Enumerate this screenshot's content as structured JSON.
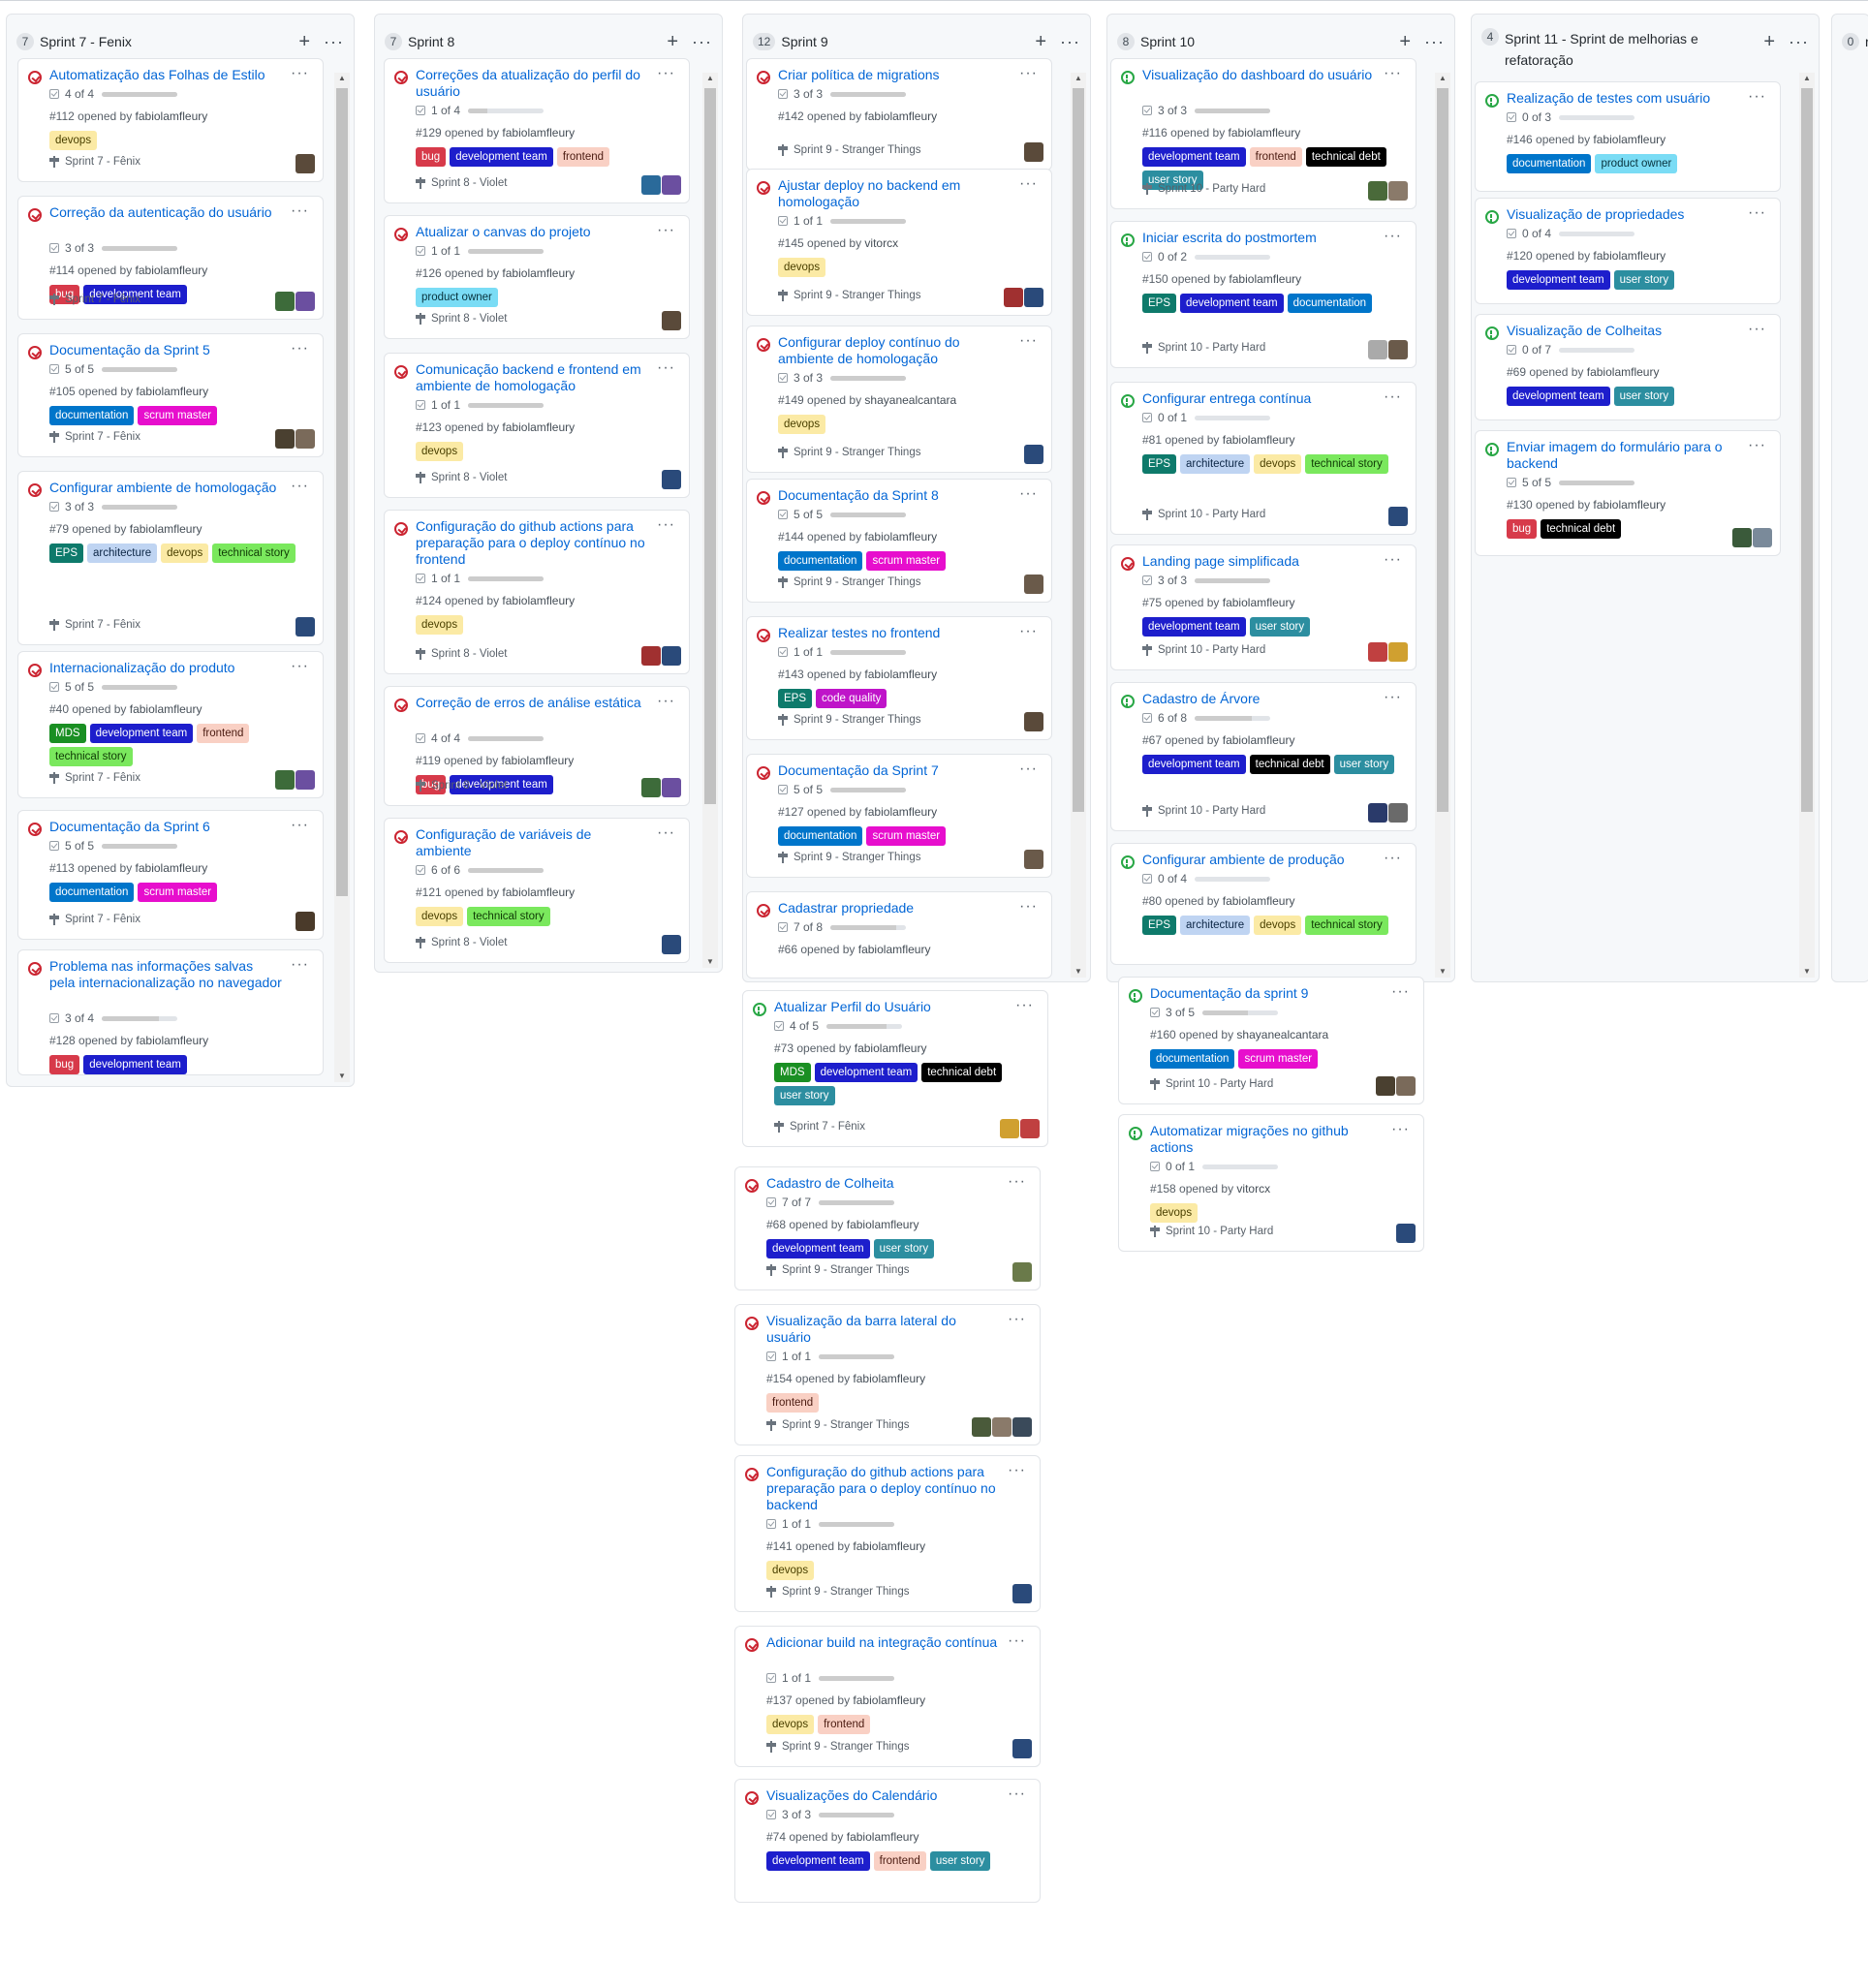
{
  "label_colors": {
    "devops": [
      "#fbeaa5",
      "#4a4000"
    ],
    "bug": [
      "#d73a4a",
      "#ffffff"
    ],
    "development team": [
      "#1d1ecc",
      "#ffffff"
    ],
    "frontend": [
      "#f9d0c4",
      "#4a1a10"
    ],
    "documentation": [
      "#0075ca",
      "#ffffff"
    ],
    "scrum master": [
      "#e70ecd",
      "#ffffff"
    ],
    "EPS": [
      "#0e7a6b",
      "#ffffff"
    ],
    "architecture": [
      "#bfd4f2",
      "#0b2545"
    ],
    "technical story": [
      "#7ae85d",
      "#0f3a05"
    ],
    "MDS": [
      "#1a8f23",
      "#ffffff"
    ],
    "product owner": [
      "#7adcf5",
      "#07313b"
    ],
    "code quality": [
      "#bf14c9",
      "#ffffff"
    ],
    "technical debt": [
      "#000000",
      "#ffffff"
    ],
    "user story": [
      "#2c8ea0",
      "#ffffff"
    ]
  },
  "columns": [
    {
      "count": "7",
      "title": "Sprint 7 - Fenix",
      "cards": [
        {
          "state": "closed",
          "title": "Automatização das Folhas de Estilo",
          "progress": "4 of 4",
          "done": 1.0,
          "number": "#112",
          "opened_by": "opened by",
          "author": "fabiolamfleury",
          "labels": [
            "devops"
          ],
          "milestone": "Sprint 7 - Fênix",
          "avatars": [
            "#5a4a3a"
          ]
        },
        {
          "state": "closed",
          "title": "Correção da autenticação do usuário",
          "progress": "3 of 3",
          "done": 1.0,
          "number": "#114",
          "opened_by": "opened by",
          "author": "fabiolamfleury",
          "labels": [
            "bug",
            "development team"
          ],
          "milestone": "Sprint 7 - Fênix",
          "avatars": [
            "#3d6b3a",
            "#6b4fa0"
          ]
        },
        {
          "state": "closed",
          "title": "Documentação da Sprint 5",
          "progress": "5 of 5",
          "done": 1.0,
          "number": "#105",
          "opened_by": "opened by",
          "author": "fabiolamfleury",
          "labels": [
            "documentation",
            "scrum master"
          ],
          "milestone": "Sprint 7 - Fênix",
          "avatars": [
            "#4a4030",
            "#7a6a5a"
          ]
        },
        {
          "state": "closed",
          "title": "Configurar ambiente de homologação",
          "progress": "3 of 3",
          "done": 1.0,
          "number": "#79",
          "opened_by": "opened by",
          "author": "fabiolamfleury",
          "labels": [
            "EPS",
            "architecture",
            "devops",
            "technical story"
          ],
          "milestone": "Sprint 7 - Fênix",
          "avatars": [
            "#2a4a7a"
          ]
        },
        {
          "state": "closed",
          "title": "Internacionalização do produto",
          "progress": "5 of 5",
          "done": 1.0,
          "number": "#40",
          "opened_by": "opened by",
          "author": "fabiolamfleury",
          "labels": [
            "MDS",
            "development team",
            "frontend",
            "technical story"
          ],
          "milestone": "Sprint 7 - Fênix",
          "avatars": [
            "#3d6b3a",
            "#6b4fa0"
          ]
        },
        {
          "state": "closed",
          "title": "Documentação da Sprint 6",
          "progress": "5 of 5",
          "done": 1.0,
          "number": "#113",
          "opened_by": "opened by",
          "author": "fabiolamfleury",
          "labels": [
            "documentation",
            "scrum master"
          ],
          "milestone": "Sprint 7 - Fênix",
          "avatars": [
            "#4a3a2a"
          ]
        },
        {
          "state": "closed",
          "title": "Problema nas informações salvas pela internacionalização no navegador",
          "progress": "3 of 4",
          "done": 0.75,
          "number": "#128",
          "opened_by": "opened by",
          "author": "fabiolamfleury",
          "labels": [
            "bug",
            "development team"
          ],
          "milestone": "",
          "avatars": []
        }
      ]
    },
    {
      "count": "7",
      "title": "Sprint 8",
      "cards": [
        {
          "state": "closed",
          "title": "Correções da atualização do perfil do usuário",
          "progress": "1 of 4",
          "done": 0.25,
          "number": "#129",
          "opened_by": "opened by",
          "author": "fabiolamfleury",
          "labels": [
            "bug",
            "development team",
            "frontend"
          ],
          "milestone": "Sprint 8 - Violet",
          "avatars": [
            "#2a6a9a",
            "#6b4fa0"
          ]
        },
        {
          "state": "closed",
          "title": "Atualizar o canvas do projeto",
          "progress": "1 of 1",
          "done": 1.0,
          "number": "#126",
          "opened_by": "opened by",
          "author": "fabiolamfleury",
          "labels": [
            "product owner"
          ],
          "milestone": "Sprint 8 - Violet",
          "avatars": [
            "#5a4a3a"
          ]
        },
        {
          "state": "closed",
          "title": "Comunicação backend e frontend em ambiente de homologação",
          "progress": "1 of 1",
          "done": 1.0,
          "number": "#123",
          "opened_by": "opened by",
          "author": "fabiolamfleury",
          "labels": [
            "devops"
          ],
          "milestone": "Sprint 8 - Violet",
          "avatars": [
            "#2a4a7a"
          ]
        },
        {
          "state": "closed",
          "title": "Configuração do github actions para preparação para o deploy contínuo no frontend",
          "progress": "1 of 1",
          "done": 1.0,
          "number": "#124",
          "opened_by": "opened by",
          "author": "fabiolamfleury",
          "labels": [
            "devops"
          ],
          "milestone": "Sprint 8 - Violet",
          "avatars": [
            "#a03030",
            "#2a4a7a"
          ]
        },
        {
          "state": "closed",
          "title": "Correção de erros de análise estática",
          "progress": "4 of 4",
          "done": 1.0,
          "number": "#119",
          "opened_by": "opened by",
          "author": "fabiolamfleury",
          "labels": [
            "bug",
            "development team"
          ],
          "milestone": "Sprint 8 - Violet",
          "avatars": [
            "#3d6b3a",
            "#6b4fa0"
          ]
        },
        {
          "state": "closed",
          "title": "Configuração de variáveis de ambiente",
          "progress": "6 of 6",
          "done": 1.0,
          "number": "#121",
          "opened_by": "opened by",
          "author": "fabiolamfleury",
          "labels": [
            "devops",
            "technical story"
          ],
          "milestone": "Sprint 8 - Violet",
          "avatars": [
            "#2a4a7a"
          ]
        }
      ]
    },
    {
      "count": "12",
      "title": "Sprint 9",
      "cards": [
        {
          "state": "closed",
          "title": "Criar política de migrations",
          "progress": "3 of 3",
          "done": 1.0,
          "number": "#142",
          "opened_by": "opened by",
          "author": "fabiolamfleury",
          "labels": [],
          "milestone": "Sprint 9 - Stranger Things",
          "avatars": [
            "#5a4a3a"
          ]
        },
        {
          "state": "closed",
          "title": "Ajustar deploy no backend em homologação",
          "progress": "1 of 1",
          "done": 1.0,
          "number": "#145",
          "opened_by": "opened by",
          "author": "vitorcx",
          "labels": [
            "devops"
          ],
          "milestone": "Sprint 9 - Stranger Things",
          "avatars": [
            "#a03030",
            "#2a4a7a"
          ]
        },
        {
          "state": "closed",
          "title": "Configurar deploy contínuo do ambiente de homologação",
          "progress": "3 of 3",
          "done": 1.0,
          "number": "#149",
          "opened_by": "opened by",
          "author": "shayanealcantara",
          "labels": [
            "devops"
          ],
          "milestone": "Sprint 9 - Stranger Things",
          "avatars": [
            "#2a4a7a"
          ]
        },
        {
          "state": "closed",
          "title": "Documentação da Sprint 8",
          "progress": "5 of 5",
          "done": 1.0,
          "number": "#144",
          "opened_by": "opened by",
          "author": "fabiolamfleury",
          "labels": [
            "documentation",
            "scrum master"
          ],
          "milestone": "Sprint 9 - Stranger Things",
          "avatars": [
            "#6a5a4a"
          ]
        },
        {
          "state": "closed",
          "title": "Realizar testes no frontend",
          "progress": "1 of 1",
          "done": 1.0,
          "number": "#143",
          "opened_by": "opened by",
          "author": "fabiolamfleury",
          "labels": [
            "EPS",
            "code quality"
          ],
          "milestone": "Sprint 9 - Stranger Things",
          "avatars": [
            "#5a4a3a"
          ]
        },
        {
          "state": "closed",
          "title": "Documentação da Sprint 7",
          "progress": "5 of 5",
          "done": 1.0,
          "number": "#127",
          "opened_by": "opened by",
          "author": "fabiolamfleury",
          "labels": [
            "documentation",
            "scrum master"
          ],
          "milestone": "Sprint 9 - Stranger Things",
          "avatars": [
            "#6a5a4a"
          ]
        },
        {
          "state": "closed",
          "title": "Cadastrar propriedade",
          "progress": "7 of 8",
          "done": 0.875,
          "number": "#66",
          "opened_by": "opened by",
          "author": "fabiolamfleury",
          "labels": [],
          "milestone": "",
          "avatars": []
        }
      ]
    },
    {
      "count": "8",
      "title": "Sprint 10",
      "cards": [
        {
          "state": "open",
          "title": "Visualização do dashboard do usuário",
          "progress": "3 of 3",
          "done": 1.0,
          "number": "#116",
          "opened_by": "opened by",
          "author": "fabiolamfleury",
          "labels": [
            "development team",
            "frontend",
            "technical debt",
            "user story"
          ],
          "milestone": "Sprint 10 - Party Hard",
          "avatars": [
            "#4a6a3a",
            "#8a7a6a"
          ]
        },
        {
          "state": "open",
          "title": "Iniciar escrita do postmortem",
          "progress": "0 of 2",
          "done": 0.0,
          "number": "#150",
          "opened_by": "opened by",
          "author": "fabiolamfleury",
          "labels": [
            "EPS",
            "development team",
            "documentation"
          ],
          "milestone": "Sprint 10 - Party Hard",
          "avatars": [
            "#aaaaaa",
            "#6a5a4a"
          ]
        },
        {
          "state": "open",
          "title": "Configurar entrega contínua",
          "progress": "0 of 1",
          "done": 0.0,
          "number": "#81",
          "opened_by": "opened by",
          "author": "fabiolamfleury",
          "labels": [
            "EPS",
            "architecture",
            "devops",
            "technical story"
          ],
          "milestone": "Sprint 10 - Party Hard",
          "avatars": [
            "#2a4a7a"
          ]
        },
        {
          "state": "closed",
          "title": "Landing page simplificada",
          "progress": "3 of 3",
          "done": 1.0,
          "number": "#75",
          "opened_by": "opened by",
          "author": "fabiolamfleury",
          "labels": [
            "development team",
            "user story"
          ],
          "milestone": "Sprint 10 - Party Hard",
          "avatars": [
            "#c04040",
            "#d0a030"
          ]
        },
        {
          "state": "open",
          "title": "Cadastro de Árvore",
          "progress": "6 of 8",
          "done": 0.75,
          "number": "#67",
          "opened_by": "opened by",
          "author": "fabiolamfleury",
          "labels": [
            "development team",
            "technical debt",
            "user story"
          ],
          "milestone": "Sprint 10 - Party Hard",
          "avatars": [
            "#2a3a6a",
            "#6a6a6a"
          ]
        },
        {
          "state": "open",
          "title": "Configurar ambiente de produção",
          "progress": "0 of 4",
          "done": 0.0,
          "number": "#80",
          "opened_by": "opened by",
          "author": "fabiolamfleury",
          "labels": [
            "EPS",
            "architecture",
            "devops",
            "technical story"
          ],
          "milestone": "",
          "avatars": []
        }
      ]
    },
    {
      "count": "4",
      "title": "Sprint 11 - Sprint de melhorias e refatoração",
      "cards": [
        {
          "state": "open",
          "title": "Realização de testes com usuário",
          "progress": "0 of 3",
          "done": 0.0,
          "number": "#146",
          "opened_by": "opened by",
          "author": "fabiolamfleury",
          "labels": [
            "documentation",
            "product owner"
          ],
          "milestone": "",
          "avatars": []
        },
        {
          "state": "open",
          "title": "Visualização de propriedades",
          "progress": "0 of 4",
          "done": 0.0,
          "number": "#120",
          "opened_by": "opened by",
          "author": "fabiolamfleury",
          "labels": [
            "development team",
            "user story"
          ],
          "milestone": "",
          "avatars": []
        },
        {
          "state": "open",
          "title": "Visualização de Colheitas",
          "progress": "0 of 7",
          "done": 0.0,
          "number": "#69",
          "opened_by": "opened by",
          "author": "fabiolamfleury",
          "labels": [
            "development team",
            "user story"
          ],
          "milestone": "",
          "avatars": []
        },
        {
          "state": "open",
          "title": "Enviar imagem do formulário para o backend",
          "progress": "5 of 5",
          "done": 1.0,
          "number": "#130",
          "opened_by": "opened by",
          "author": "fabiolamfleury",
          "labels": [
            "bug",
            "technical debt"
          ],
          "milestone": "",
          "avatars": [
            "#3a5a3a",
            "#7a8a9a"
          ]
        }
      ]
    },
    {
      "count": "0",
      "title": "refa",
      "cards": []
    }
  ],
  "floating_cards": [
    {
      "state": "open",
      "title": "Atualizar Perfil do Usuário",
      "progress": "4 of 5",
      "done": 0.8,
      "number": "#73",
      "opened_by": "opened by",
      "author": "fabiolamfleury",
      "labels": [
        "MDS",
        "development team",
        "technical debt",
        "user story"
      ],
      "milestone": "Sprint 7 - Fênix",
      "avatars": [
        "#d0a030",
        "#c04040"
      ]
    },
    {
      "state": "closed",
      "title": "Cadastro de Colheita",
      "progress": "7 of 7",
      "done": 1.0,
      "number": "#68",
      "opened_by": "opened by",
      "author": "fabiolamfleury",
      "labels": [
        "development team",
        "user story"
      ],
      "milestone": "Sprint 9 - Stranger Things",
      "avatars": [
        "#6a7a4a"
      ]
    },
    {
      "state": "closed",
      "title": "Visualização da barra lateral do usuário",
      "progress": "1 of 1",
      "done": 1.0,
      "number": "#154",
      "opened_by": "opened by",
      "author": "fabiolamfleury",
      "labels": [
        "frontend"
      ],
      "milestone": "Sprint 9 - Stranger Things",
      "avatars": [
        "#4a5a3a",
        "#8a7a6a",
        "#3a4a5a"
      ]
    },
    {
      "state": "closed",
      "title": "Configuração do github actions para preparação para o deploy contínuo no backend",
      "progress": "1 of 1",
      "done": 1.0,
      "number": "#141",
      "opened_by": "opened by",
      "author": "fabiolamfleury",
      "labels": [
        "devops"
      ],
      "milestone": "Sprint 9 - Stranger Things",
      "avatars": [
        "#2a4a7a"
      ]
    },
    {
      "state": "closed",
      "title": "Adicionar build na integração contínua",
      "progress": "1 of 1",
      "done": 1.0,
      "number": "#137",
      "opened_by": "opened by",
      "author": "fabiolamfleury",
      "labels": [
        "devops",
        "frontend"
      ],
      "milestone": "Sprint 9 - Stranger Things",
      "avatars": [
        "#2a4a7a"
      ]
    },
    {
      "state": "closed",
      "title": "Visualizações do Calendário",
      "progress": "3 of 3",
      "done": 1.0,
      "number": "#74",
      "opened_by": "opened by",
      "author": "fabiolamfleury",
      "labels": [
        "development team",
        "frontend",
        "user story"
      ],
      "milestone": "",
      "avatars": []
    },
    {
      "state": "open",
      "title": "Documentação da sprint 9",
      "progress": "3 of 5",
      "done": 0.6,
      "number": "#160",
      "opened_by": "opened by",
      "author": "shayanealcantara",
      "labels": [
        "documentation",
        "scrum master"
      ],
      "milestone": "Sprint 10 - Party Hard",
      "avatars": [
        "#4a4030",
        "#7a6a5a"
      ]
    },
    {
      "state": "open",
      "title": "Automatizar migrações no github actions",
      "progress": "0 of 1",
      "done": 0.0,
      "number": "#158",
      "opened_by": "opened by",
      "author": "vitorcx",
      "labels": [
        "devops"
      ],
      "milestone": "Sprint 10 - Party Hard",
      "avatars": [
        "#2a4a7a"
      ]
    }
  ]
}
